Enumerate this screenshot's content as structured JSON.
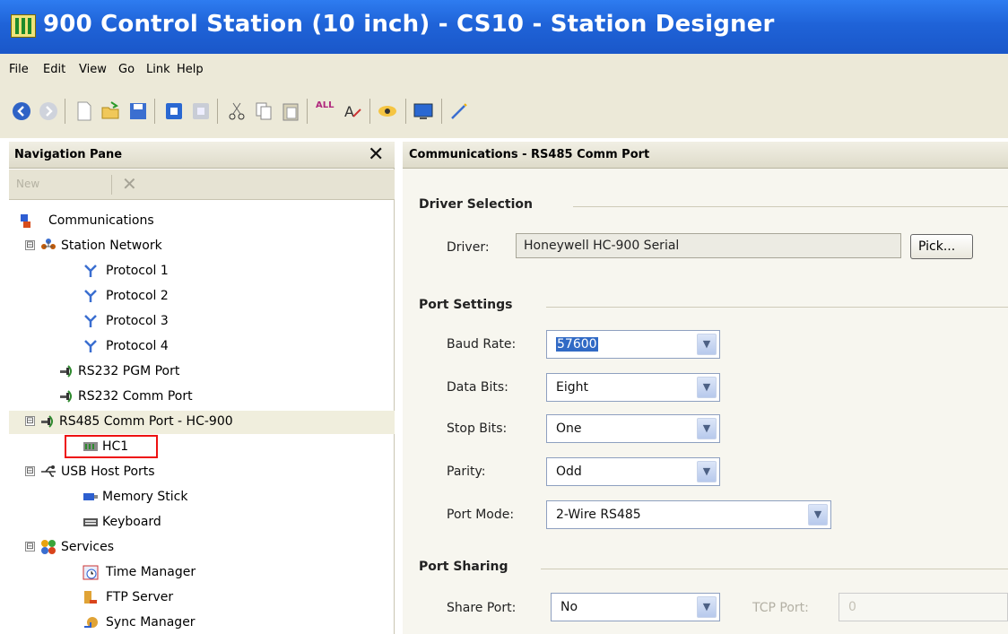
{
  "window": {
    "title": "900 Control Station (10 inch) - CS10 - Station Designer"
  },
  "menu": [
    "File",
    "Edit",
    "View",
    "Go",
    "Link",
    "Help"
  ],
  "toolbar": {
    "icons": [
      "back-icon",
      "forward-icon",
      "new-file-icon",
      "open-folder-icon",
      "save-icon",
      "blue-square-icon",
      "gray-square-icon",
      "cut-icon",
      "copy-icon",
      "paste-icon",
      "all-icon",
      "spell-icon",
      "eye-icon",
      "monitor-icon",
      "wand-icon"
    ],
    "all_label": "ALL"
  },
  "nav": {
    "title": "Navigation Pane",
    "close_glyph": "✕",
    "toolbar_faded": "New",
    "tree": [
      {
        "label": "Communications",
        "icon": "communications-icon",
        "level": 0
      },
      {
        "label": "Station Network",
        "icon": "network-icon",
        "level": 1,
        "expander": "⊟"
      },
      {
        "label": "Protocol 1",
        "icon": "protocol-icon",
        "level": 2
      },
      {
        "label": "Protocol 2",
        "icon": "protocol-icon",
        "level": 2
      },
      {
        "label": "Protocol 3",
        "icon": "protocol-icon",
        "level": 2
      },
      {
        "label": "Protocol 4",
        "icon": "protocol-icon",
        "level": 2
      },
      {
        "label": "RS232 PGM Port",
        "icon": "serial-port-icon",
        "level": 1
      },
      {
        "label": "RS232 Comm Port",
        "icon": "serial-port-icon",
        "level": 1
      },
      {
        "label": "RS485 Comm Port - HC-900",
        "icon": "serial-port-icon",
        "level": 1,
        "expander": "⊟",
        "selected": true
      },
      {
        "label": "HC1",
        "icon": "controller-icon",
        "level": 2
      },
      {
        "label": "USB Host Ports",
        "icon": "usb-icon",
        "level": 1,
        "expander": "⊟"
      },
      {
        "label": "Memory Stick",
        "icon": "memory-stick-icon",
        "level": 2
      },
      {
        "label": "Keyboard",
        "icon": "keyboard-icon",
        "level": 2
      },
      {
        "label": "Services",
        "icon": "services-icon",
        "level": 1,
        "expander": "⊟"
      },
      {
        "label": "Time Manager",
        "icon": "time-manager-icon",
        "level": 2
      },
      {
        "label": "FTP Server",
        "icon": "ftp-server-icon",
        "level": 2
      },
      {
        "label": "Sync Manager",
        "icon": "sync-manager-icon",
        "level": 2
      }
    ]
  },
  "content": {
    "title": "Communications - RS485 Comm Port",
    "driver_section": {
      "title": "Driver Selection",
      "driver_label": "Driver:",
      "driver_value": "Honeywell HC-900 Serial",
      "pick_label": "Pick..."
    },
    "port_settings": {
      "title": "Port Settings",
      "baud_rate": {
        "label": "Baud Rate:",
        "value": "57600"
      },
      "data_bits": {
        "label": "Data Bits:",
        "value": "Eight"
      },
      "stop_bits": {
        "label": "Stop Bits:",
        "value": "One"
      },
      "parity": {
        "label": "Parity:",
        "value": "Odd"
      },
      "port_mode": {
        "label": "Port Mode:",
        "value": "2-Wire RS485"
      }
    },
    "port_sharing": {
      "title": "Port Sharing",
      "share_port": {
        "label": "Share Port:",
        "value": "No"
      },
      "tcp_port": {
        "label": "TCP Port:",
        "value": "0"
      }
    }
  }
}
